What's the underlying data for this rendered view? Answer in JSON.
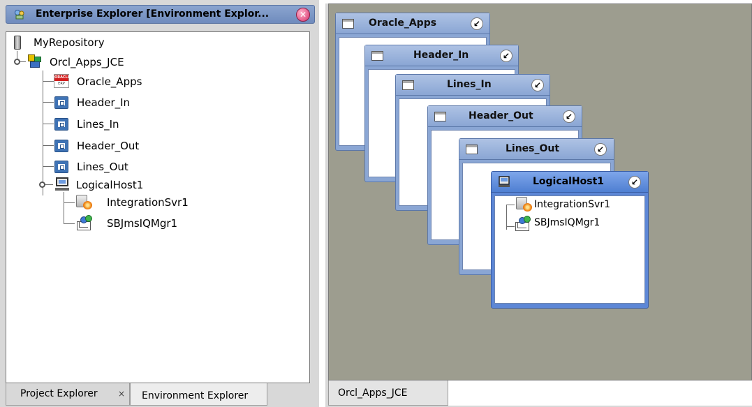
{
  "left_panel": {
    "title": "Enterprise Explorer [Environment Explor...",
    "tree": {
      "root": "MyRepository",
      "env": "Orcl_Apps_JCE",
      "children": [
        "Oracle_Apps",
        "Header_In",
        "Lines_In",
        "Header_Out",
        "Lines_Out",
        "LogicalHost1"
      ],
      "host_children": [
        "IntegrationSvr1",
        "SBJmsIQMgr1"
      ],
      "oracle_icon": {
        "top": "ORACLE",
        "bottom": "ERP"
      }
    },
    "tabs": [
      {
        "label": "Project Explorer",
        "close": "×"
      },
      {
        "label": "Environment Explorer"
      }
    ]
  },
  "canvas": {
    "windows": [
      {
        "title": "Oracle_Apps"
      },
      {
        "title": "Header_In"
      },
      {
        "title": "Lines_In"
      },
      {
        "title": "Header_Out"
      },
      {
        "title": "Lines_Out"
      },
      {
        "title": "LogicalHost1",
        "items": [
          "IntegrationSvr1",
          "SBJmsIQMgr1"
        ]
      }
    ],
    "tab": "Orcl_Apps_JCE"
  },
  "colors": {
    "title_bar": "#8ba5cf",
    "canvas_bg": "#9d9d8f",
    "window_header": "#8aa6d4",
    "active_window_header": "#4f7fd2",
    "close_button": "#d6306a"
  },
  "icons": {
    "app": "explorer-app-icon",
    "close": "close-icon",
    "repository": "repository-icon",
    "environment": "environment-icon",
    "oracle": "oracle-erp-icon",
    "component": "component-icon",
    "logical_host": "logical-host-icon",
    "integration_server": "integration-server-icon",
    "jms": "jms-iq-manager-icon",
    "maximize": "restore-icon"
  }
}
